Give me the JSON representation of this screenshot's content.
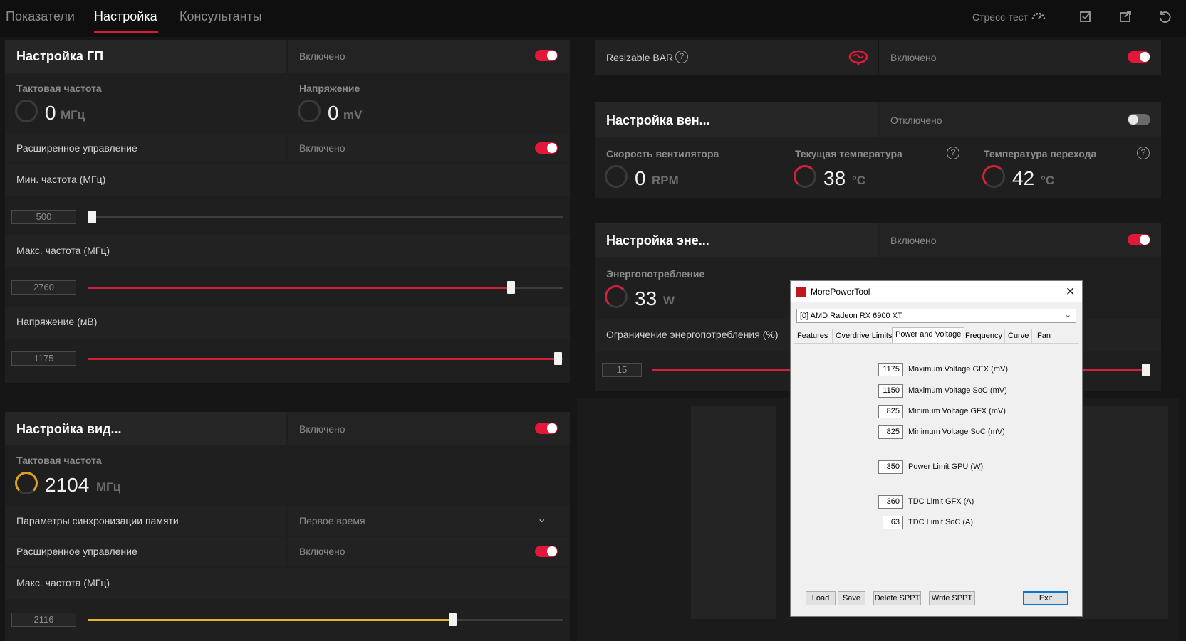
{
  "tabs": [
    {
      "label": "Показатели"
    },
    {
      "label": "Настройка"
    },
    {
      "label": "Консультанты"
    }
  ],
  "toolbar": {
    "stress_test": "Стресс-тест"
  },
  "accent": "#e2173a",
  "gpu_tuning": {
    "title": "Настройка ГП",
    "state": "Включено",
    "clock": {
      "label": "Тактовая частота",
      "value": "0",
      "unit": "МГц"
    },
    "voltage": {
      "label": "Напряжение",
      "value": "0",
      "unit": "mV"
    },
    "advanced": {
      "label": "Расширенное управление",
      "state": "Включено"
    },
    "min_freq": {
      "label": "Мин. частота (МГц)",
      "value": "500",
      "level": 0.0
    },
    "max_freq": {
      "label": "Макс. частота (МГц)",
      "value": "2760",
      "level": 0.9
    },
    "volt_mv": {
      "label": "Напряжение (мВ)",
      "value": "1175",
      "level": 1.0
    }
  },
  "vram_tuning": {
    "title": "Настройка вид...",
    "state": "Включено",
    "clock": {
      "label": "Тактовая частота",
      "value": "2104",
      "unit": "МГц"
    },
    "timing": {
      "label": "Параметры синхронизации памяти",
      "value": "Первое время"
    },
    "advanced": {
      "label": "Расширенное управление",
      "state": "Включено"
    },
    "max_freq": {
      "label": "Макс. частота (МГц)",
      "value": "2116",
      "level": 0.77
    }
  },
  "resizable_bar": {
    "label": "Resizable BAR",
    "state": "Включено"
  },
  "fan_tuning": {
    "title": "Настройка вен...",
    "state": "Отключено",
    "fan_speed": {
      "label": "Скорость вентилятора",
      "value": "0",
      "unit": "RPM"
    },
    "cur_temp": {
      "label": "Текущая температура",
      "value": "38",
      "unit": "°C"
    },
    "junction_temp": {
      "label": "Температура перехода",
      "value": "42",
      "unit": "°C"
    }
  },
  "power_tuning": {
    "title": "Настройка эне...",
    "state": "Включено",
    "power": {
      "label": "Энергопотребление",
      "value": "33",
      "unit": "W"
    },
    "limit": {
      "label": "Ограничение энергопотребления (%)",
      "value": "15",
      "level": 1.0
    }
  },
  "mpt": {
    "title": "MorePowerTool",
    "device": "[0] AMD Radeon RX 6900 XT",
    "tabs": [
      "Features",
      "Overdrive Limits",
      "Power and Voltage",
      "Frequency",
      "Curve",
      "Fan"
    ],
    "fields": [
      {
        "value": "1175",
        "label": "Maximum Voltage GFX (mV)"
      },
      {
        "value": "1150",
        "label": "Maximum Voltage SoC (mV)"
      },
      {
        "value": "825",
        "label": "Minimum Voltage GFX (mV)"
      },
      {
        "value": "825",
        "label": "Minimum Voltage SoC (mV)"
      },
      {
        "value": "350",
        "label": "Power Limit GPU (W)"
      },
      {
        "value": "360",
        "label": "TDC Limit GFX (A)"
      },
      {
        "value": "63",
        "label": "TDC Limit SoC (A)"
      }
    ],
    "buttons": {
      "load": "Load",
      "save": "Save",
      "delete": "Delete SPPT",
      "write": "Write SPPT",
      "exit": "Exit"
    }
  }
}
